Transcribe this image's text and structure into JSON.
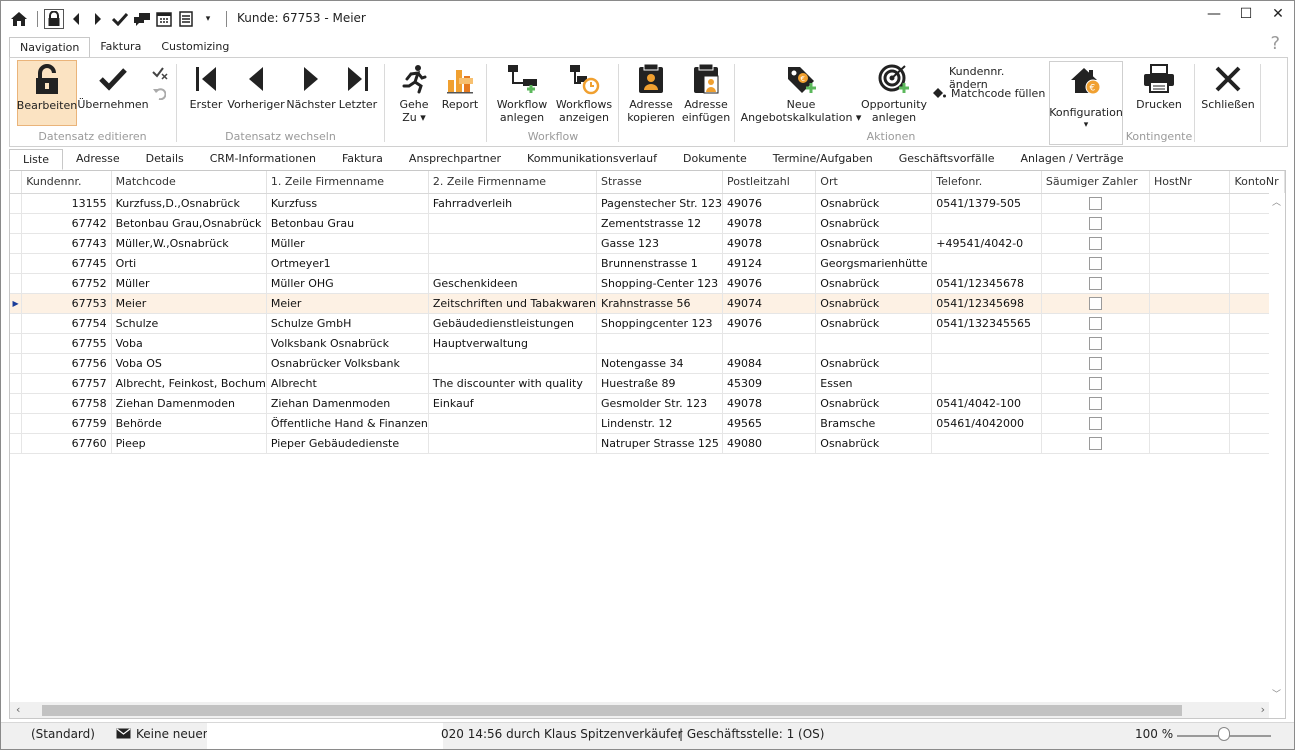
{
  "title": "Kunde: 67753 - Meier",
  "qat_icons": [
    "home-icon",
    "lock-icon",
    "prev-icon",
    "next-icon",
    "check-icon",
    "comments-icon",
    "calendar-icon",
    "list-icon",
    "dropdown-icon"
  ],
  "ribbon_tabs": [
    "Navigation",
    "Faktura",
    "Customizing"
  ],
  "help": "?",
  "groups": {
    "edit": "Datensatz editieren",
    "switch": "Datensatz wechseln",
    "workflow": "Workflow",
    "actions": "Aktionen",
    "quotas": "Kontingente"
  },
  "buttons": {
    "bearbeiten": "Bearbeiten",
    "uebernehmen": "Übernehmen",
    "erster": "Erster",
    "vorheriger": "Vorheriger",
    "naechster": "Nächster",
    "letzter": "Letzter",
    "gehe_zu_1": "Gehe",
    "gehe_zu_2": "Zu ▾",
    "report": "Report",
    "workflow_anlegen_1": "Workflow",
    "workflow_anlegen_2": "anlegen",
    "workflows_anzeigen_1": "Workflows",
    "workflows_anzeigen_2": "anzeigen",
    "adresse_kopieren_1": "Adresse",
    "adresse_kopieren_2": "kopieren",
    "adresse_einfuegen_1": "Adresse",
    "adresse_einfuegen_2": "einfügen",
    "neue_angebot_1": "Neue",
    "neue_angebot_2": "Angebotskalkulation ▾",
    "opportunity_1": "Opportunity",
    "opportunity_2": "anlegen",
    "kundennr_aendern": "Kundennr. ändern",
    "matchcode_fuellen": "Matchcode füllen",
    "konfiguration": "Konfiguration",
    "konfiguration_arrow": "▾",
    "drucken": "Drucken",
    "schliessen": "Schließen"
  },
  "content_tabs": [
    "Liste",
    "Adresse",
    "Details",
    "CRM-Informationen",
    "Faktura",
    "Ansprechpartner",
    "Kommunikationsverlauf",
    "Dokumente",
    "Termine/Aufgaben",
    "Geschäftsvorfälle",
    "Anlagen / Verträge"
  ],
  "columns": [
    "Kundennr.",
    "Matchcode",
    "1. Zeile Firmenname",
    "2. Zeile Firmenname",
    "Strasse",
    "Postleitzahl",
    "Ort",
    "Telefonr.",
    "Säumiger Zahler",
    "HostNr",
    "KontoNr"
  ],
  "rows": [
    {
      "kundennr": "13155",
      "matchcode": "Kurzfuss,D.,Osnabrück",
      "firma1": "Kurzfuss",
      "firma2": "Fahrradverleih",
      "strasse": "Pagenstecher Str. 123",
      "plz": "49076",
      "ort": "Osnabrück",
      "tel": "0541/1379-505"
    },
    {
      "kundennr": "67742",
      "matchcode": "Betonbau Grau,Osnabrück",
      "firma1": "Betonbau Grau",
      "firma2": "",
      "strasse": "Zementstrasse 12",
      "plz": "49078",
      "ort": "Osnabrück",
      "tel": ""
    },
    {
      "kundennr": "67743",
      "matchcode": "Müller,W.,Osnabrück",
      "firma1": "Müller",
      "firma2": "",
      "strasse": "Gasse 123",
      "plz": "49078",
      "ort": "Osnabrück",
      "tel": "+49541/4042-0"
    },
    {
      "kundennr": "67745",
      "matchcode": "Orti",
      "firma1": "Ortmeyer1",
      "firma2": "",
      "strasse": "Brunnenstrasse 1",
      "plz": "49124",
      "ort": "Georgsmarienhütte",
      "tel": ""
    },
    {
      "kundennr": "67752",
      "matchcode": "Müller",
      "firma1": "Müller OHG",
      "firma2": "Geschenkideen",
      "strasse": "Shopping-Center 123",
      "plz": "49076",
      "ort": "Osnabrück",
      "tel": "0541/12345678"
    },
    {
      "kundennr": "67753",
      "matchcode": "Meier",
      "firma1": "Meier",
      "firma2": "Zeitschriften und Tabakwaren",
      "strasse": "Krahnstrasse 56",
      "plz": "49074",
      "ort": "Osnabrück",
      "tel": "0541/12345698"
    },
    {
      "kundennr": "67754",
      "matchcode": "Schulze",
      "firma1": "Schulze GmbH",
      "firma2": "Gebäudedienstleistungen",
      "strasse": "Shoppingcenter 123",
      "plz": "49076",
      "ort": "Osnabrück",
      "tel": "0541/132345565"
    },
    {
      "kundennr": "67755",
      "matchcode": "Voba",
      "firma1": "Volksbank Osnabrück",
      "firma2": "Hauptverwaltung",
      "strasse": "",
      "plz": "",
      "ort": "",
      "tel": ""
    },
    {
      "kundennr": "67756",
      "matchcode": "Voba OS",
      "firma1": "Osnabrücker Volksbank",
      "firma2": "",
      "strasse": "Notengasse 34",
      "plz": "49084",
      "ort": "Osnabrück",
      "tel": ""
    },
    {
      "kundennr": "67757",
      "matchcode": "Albrecht, Feinkost, Bochum",
      "firma1": "Albrecht",
      "firma2": "The discounter with quality",
      "strasse": "Huestraße 89",
      "plz": "45309",
      "ort": "Essen",
      "tel": ""
    },
    {
      "kundennr": "67758",
      "matchcode": "Ziehan Damenmoden",
      "firma1": "Ziehan Damenmoden",
      "firma2": "Einkauf",
      "strasse": "Gesmolder Str. 123",
      "plz": "49078",
      "ort": "Osnabrück",
      "tel": "0541/4042-100"
    },
    {
      "kundennr": "67759",
      "matchcode": "Behörde",
      "firma1": "Öffentliche Hand & Finanzen",
      "firma2": "",
      "strasse": "Lindenstr. 12",
      "plz": "49565",
      "ort": "Bramsche",
      "tel": "05461/4042000"
    },
    {
      "kundennr": "67760",
      "matchcode": "Pieep",
      "firma1": "Pieper Gebäudedienste",
      "firma2": "",
      "strasse": "Natruper Strasse 125",
      "plz": "49080",
      "ort": "Osnabrück",
      "tel": ""
    }
  ],
  "selected_row": 5,
  "status": {
    "standard": "(Standard)",
    "messages": "Keine neuen N",
    "changed": "020 14:56 durch Klaus Spitzenverkäufer",
    "office": "| Geschäftsstelle:  1 (OS)",
    "zoom": "100 %"
  },
  "colors": {
    "accent_orange": "#f0a030",
    "selection": "#fdf1e4",
    "highlight_button": "#fbe3c2",
    "green": "#5cb85c"
  }
}
